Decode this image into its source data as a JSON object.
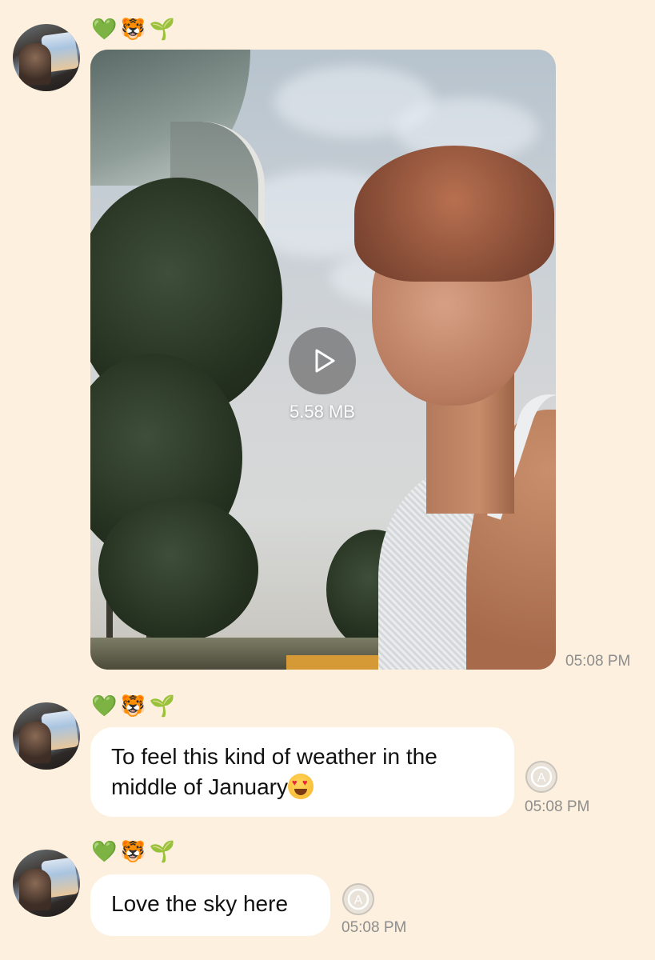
{
  "sender": {
    "emoji_heart": "💚",
    "emoji_tiger": "🐯",
    "emoji_sprout": "🌱"
  },
  "messages": [
    {
      "type": "video",
      "file_size": "5.58 MB",
      "time": "05:08 PM"
    },
    {
      "type": "text",
      "text": "To feel this kind of weather in the middle of January",
      "emoji": "😍",
      "time": "05:08 PM"
    },
    {
      "type": "text",
      "text": "Love the sky here",
      "time": "05:08 PM"
    }
  ],
  "colors": {
    "background": "#fdf0de",
    "bubble": "#ffffff",
    "time": "#8d8d8d"
  }
}
